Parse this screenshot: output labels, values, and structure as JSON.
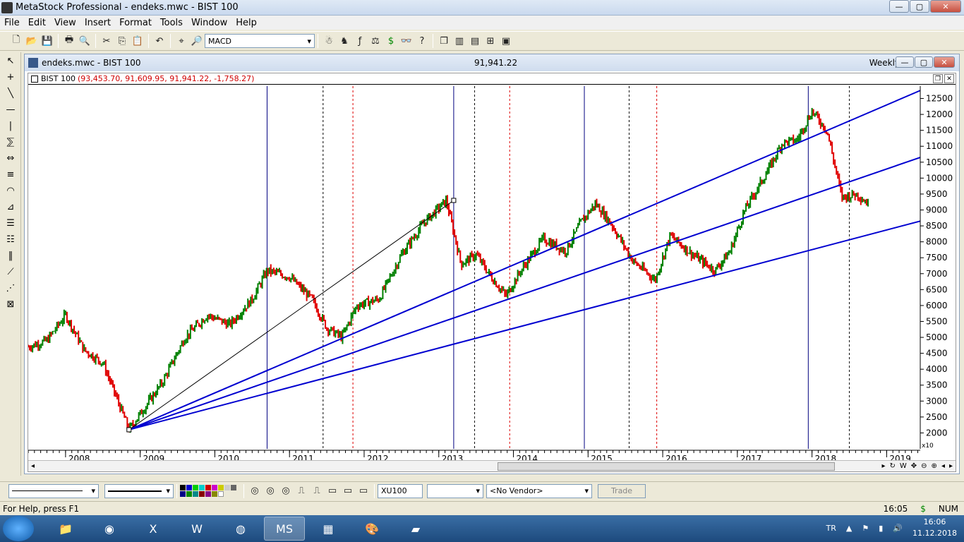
{
  "window": {
    "title": "MetaStock Professional - endeks.mwc - BIST 100",
    "min": "—",
    "max": "▢",
    "close": "✕"
  },
  "menu": [
    "File",
    "Edit",
    "View",
    "Insert",
    "Format",
    "Tools",
    "Window",
    "Help"
  ],
  "toolbar": {
    "indicator_combo": "MACD"
  },
  "chart_window": {
    "title": "endeks.mwc - BIST 100",
    "price": "91,941.22",
    "period": "Weekly"
  },
  "chart_header": {
    "symbol": "BIST 100",
    "values": "(93,453.70, 91,609.95, 91,941.22, -1,758.27)"
  },
  "chart_data": {
    "type": "line",
    "series": [
      {
        "values_x": [
          2007.5,
          2007.75,
          2008.0,
          2008.25,
          2008.5,
          2008.85,
          2009.0,
          2009.3,
          2009.6,
          2009.9,
          2010.2,
          2010.5,
          2010.7,
          2011.0,
          2011.3,
          2011.5,
          2011.7,
          2011.9,
          2012.2,
          2012.5,
          2012.8,
          2013.1,
          2013.3,
          2013.5,
          2013.7,
          2013.9,
          2014.1,
          2014.4,
          2014.7,
          2014.9,
          2015.1,
          2015.3,
          2015.6,
          2015.9,
          2016.1,
          2016.4,
          2016.7,
          2016.9,
          2017.1,
          2017.4,
          2017.6,
          2017.8,
          2018.0,
          2018.2,
          2018.4,
          2018.6,
          2018.75
        ],
        "values_y": [
          4700,
          4900,
          5700,
          4600,
          4200,
          2100,
          2600,
          3600,
          5000,
          5700,
          5400,
          6200,
          7100,
          6900,
          6200,
          5300,
          5000,
          6000,
          6200,
          7600,
          8600,
          9300,
          7300,
          7600,
          6900,
          6300,
          7100,
          8100,
          7700,
          8600,
          9200,
          8600,
          7400,
          6800,
          8200,
          7600,
          7100,
          7700,
          9000,
          10200,
          11100,
          11200,
          12100,
          11500,
          9400,
          9500,
          9200
        ]
      }
    ],
    "title": "BIST 100",
    "ylim": [
      1500,
      12500
    ],
    "ylabel_ticks": [
      "12500",
      "12000",
      "11500",
      "11000",
      "10500",
      "10000",
      "9500",
      "9000",
      "8500",
      "8000",
      "7500",
      "7000",
      "6500",
      "6000",
      "5500",
      "5000",
      "4500",
      "4000",
      "3500",
      "3000",
      "2500",
      "2000"
    ],
    "x_ticks": [
      "2008",
      "2009",
      "2010",
      "2011",
      "2012",
      "2013",
      "2014",
      "2015",
      "2016",
      "2017",
      "2018",
      "2019"
    ],
    "scale_label": "x10"
  },
  "bottombar": {
    "symbol": "XU100",
    "vendor": "<No Vendor>",
    "trade": "Trade"
  },
  "status": {
    "help": "For Help, press F1",
    "time": "16:05",
    "dollar": "$",
    "num": "NUM"
  },
  "taskbar": {
    "lang": "TR",
    "clock_time": "16:06",
    "clock_date": "11.12.2018"
  }
}
